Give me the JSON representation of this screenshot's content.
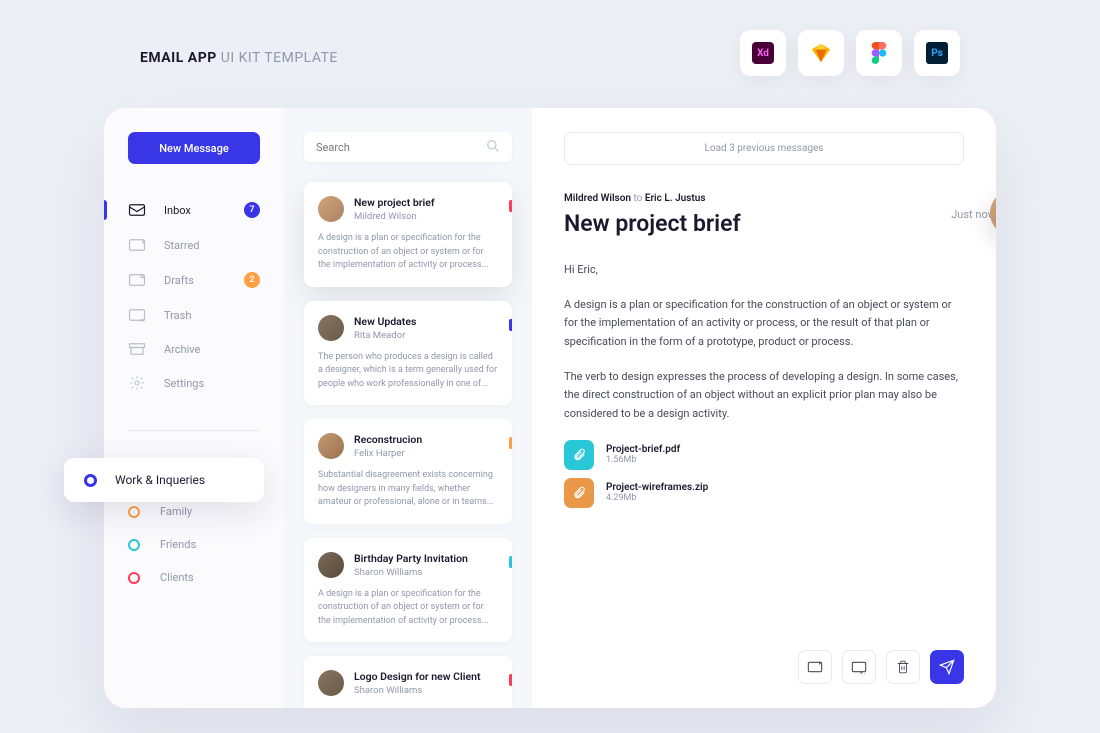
{
  "header": {
    "title_bold": "EMAIL APP",
    "title_light": "UI KIT TEMPLATE"
  },
  "sidebar": {
    "new_message": "New Message",
    "nav": [
      {
        "label": "Inbox",
        "badge": "7"
      },
      {
        "label": "Starred"
      },
      {
        "label": "Drafts",
        "badge": "2"
      },
      {
        "label": "Trash"
      },
      {
        "label": "Archive"
      },
      {
        "label": "Settings"
      }
    ],
    "tags": [
      {
        "label": "Work & Inqueries",
        "color": "#3836e6"
      },
      {
        "label": "Family",
        "color": "#ff9f43"
      },
      {
        "label": "Friends",
        "color": "#29c7d8"
      },
      {
        "label": "Clients",
        "color": "#ff3b5c"
      }
    ]
  },
  "search": {
    "placeholder": "Search"
  },
  "emails": [
    {
      "subject": "New project brief",
      "sender": "Mildred Wilson",
      "preview": "A design is a plan or specification for the construction of an object or system or for the implementation of activity or process...",
      "accent": "#ff3b5c"
    },
    {
      "subject": "New Updates",
      "sender": "Rita Meador",
      "preview": "The person who produces a design is called a designer, which is a term generally used for people who work professionally in one of...",
      "accent": "#3836e6"
    },
    {
      "subject": "Reconstrucion",
      "sender": "Felix Harper",
      "preview": "Substantial disagreement exists concerning how designers in many fields, whether amateur or professional, alone or in teams...",
      "accent": "#ff9f43"
    },
    {
      "subject": "Birthday Party Invitation",
      "sender": "Sharon Williams",
      "preview": "A design is a plan or specification for the construction of an object or system or for the implementation of activity or process...",
      "accent": "#29c7d8"
    },
    {
      "subject": "Logo Design for new Client",
      "sender": "Sharon Williams",
      "preview": "",
      "accent": "#ff3b5c"
    }
  ],
  "content": {
    "load_previous": "Load 3 previous messages",
    "from": "Mildred Wilson",
    "to_label": "to",
    "to": "Eric L. Justus",
    "subject": "New project brief",
    "timestamp": "Just now",
    "greeting": "Hi Eric,",
    "para1": "A design is a plan or specification for the construction of an object or system or for the implementation of an activity or process, or the result of that plan or specification in the form of a prototype, product or process.",
    "para2": "The verb to design expresses the process of developing a design. In some cases, the direct construction of an object without an explicit prior plan may also be considered to be a design activity.",
    "attachments": [
      {
        "name": "Project-brief.pdf",
        "size": "1.56Mb",
        "color": "cyan"
      },
      {
        "name": "Project-wireframes.zip",
        "size": "4.29Mb",
        "color": "orange"
      }
    ]
  }
}
